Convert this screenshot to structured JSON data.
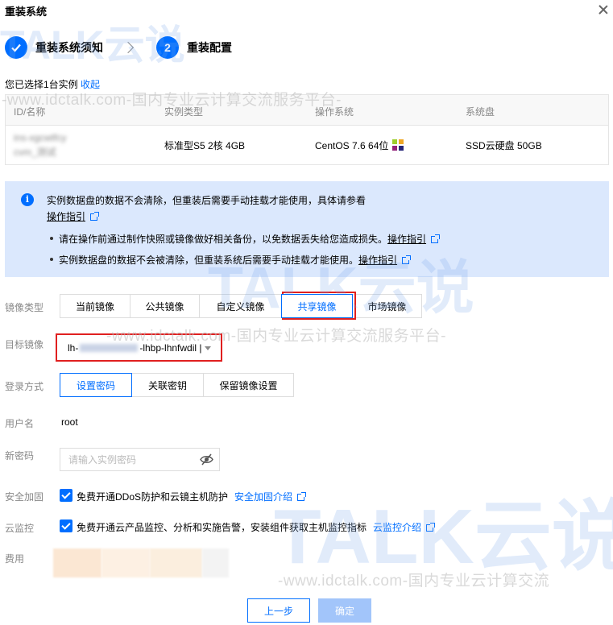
{
  "dialog": {
    "title": "重装系统"
  },
  "steps": [
    {
      "number": "",
      "label": "重装系统须知",
      "state": "done"
    },
    {
      "number": "2",
      "label": "重装配置",
      "state": "current"
    }
  ],
  "selection": {
    "text": "您已选择1台实例",
    "collapse_link": "收起"
  },
  "instance_table": {
    "headers": [
      "ID/名称",
      "实例类型",
      "操作系统",
      "系统盘"
    ],
    "rows": [
      {
        "id": "ins-xgcwtfcy",
        "name": "cvm_测试",
        "type": "标准型S5 2核 4GB",
        "os": "CentOS 7.6 64位",
        "disk": "SSD云硬盘 50GB"
      }
    ]
  },
  "notice": {
    "line1": "实例数据盘的数据不会清除，但重装后需要手动挂载才能使用，具体请参看",
    "line1_link": "操作指引",
    "bullets": [
      {
        "text": "请在操作前通过制作快照或镜像做好相关备份，以免数据丢失给您造成损失。",
        "link": "操作指引"
      },
      {
        "text": "实例数据盘的数据不会被清除，但重装系统后需要手动挂载才能使用。",
        "link": "操作指引"
      }
    ]
  },
  "form": {
    "image_type": {
      "label": "镜像类型",
      "options": [
        "当前镜像",
        "公共镜像",
        "自定义镜像",
        "共享镜像",
        "市场镜像"
      ],
      "selected": "共享镜像"
    },
    "target_image": {
      "label": "目标镜像",
      "value_prefix": "lh-",
      "value_hidden": "1254240205",
      "value_suffix": "-lhbp-lhnfwdil |"
    },
    "login": {
      "label": "登录方式",
      "options": [
        "设置密码",
        "关联密钥",
        "保留镜像设置"
      ],
      "selected": "设置密码"
    },
    "username": {
      "label": "用户名",
      "value": "root"
    },
    "password": {
      "label": "新密码",
      "placeholder": "请输入实例密码"
    },
    "security": {
      "label": "安全加固",
      "text": "免费开通DDoS防护和云镜主机防护",
      "link": "安全加固介绍",
      "checked": true
    },
    "monitor": {
      "label": "云监控",
      "text": "免费开通云产品监控、分析和实施告警，安装组件获取主机监控指标",
      "link": "云监控介绍",
      "checked": true
    },
    "fee": {
      "label": "费用"
    }
  },
  "buttons": {
    "prev": "上一步",
    "ok": "确定"
  },
  "watermark": {
    "brand": "TALK云说",
    "line": "-www.idctalk.com-国内专业云计算交流服务平台-",
    "line_short": "-www.idctalk.com-国内专业云计算交流"
  },
  "colors": {
    "primary": "#006eff",
    "highlight": "#e02020",
    "notice_bg": "#dbe8fd",
    "disabled": "#a2c5fa"
  }
}
